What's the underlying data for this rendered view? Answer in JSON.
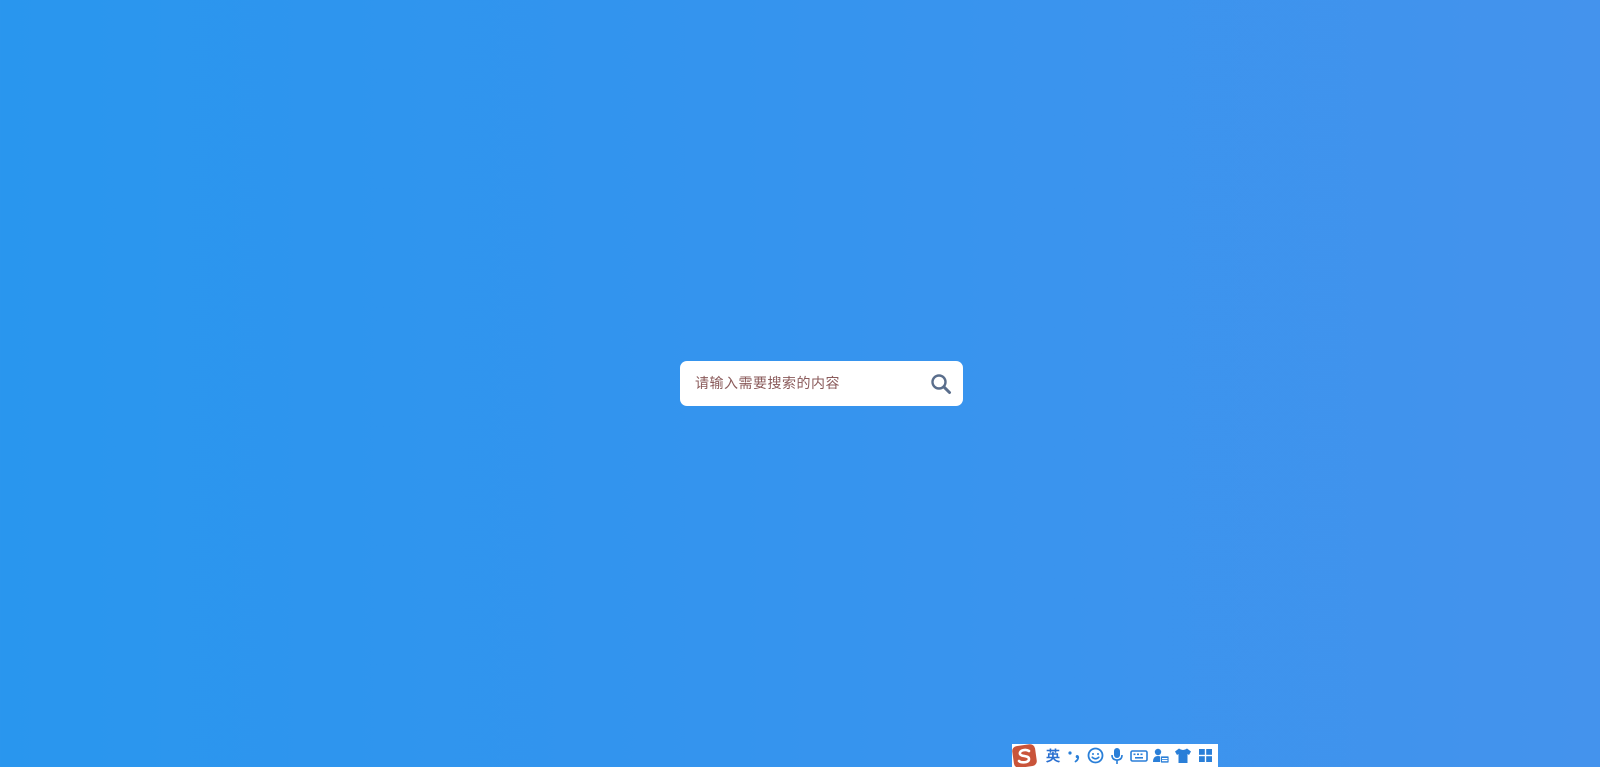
{
  "search": {
    "placeholder": "请输入需要搜索的内容",
    "value": ""
  },
  "ime_toolbar": {
    "language_label": "英",
    "items": [
      "logo-icon",
      "punctuation-icon",
      "emoji-icon",
      "microphone-icon",
      "keyboard-icon",
      "user-icon",
      "skin-icon",
      "toolbox-icon"
    ]
  },
  "colors": {
    "background_start": "#2996ee",
    "background_end": "#4493ed",
    "search_box": "#ffffff",
    "search_icon": "#5a6e8c",
    "ime_accent": "#2a7fd8",
    "ime_logo": "#c9543a"
  }
}
